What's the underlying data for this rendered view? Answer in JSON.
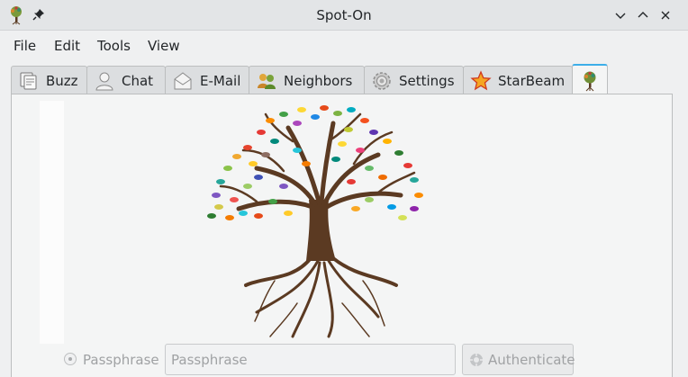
{
  "window": {
    "title": "Spot-On",
    "icons": [
      "app-tree-icon",
      "pin-icon",
      "minimize-icon",
      "maximize-icon",
      "close-icon"
    ]
  },
  "menubar": {
    "items": [
      {
        "label": "File"
      },
      {
        "label": "Edit"
      },
      {
        "label": "Tools"
      },
      {
        "label": "View"
      }
    ]
  },
  "tabs": [
    {
      "label": "Buzz",
      "icon": "buzz-icon"
    },
    {
      "label": "Chat",
      "icon": "chat-person-icon"
    },
    {
      "label": "E-Mail",
      "icon": "email-envelope-icon"
    },
    {
      "label": "Neighbors",
      "icon": "neighbors-people-icon"
    },
    {
      "label": "Settings",
      "icon": "settings-gear-icon"
    },
    {
      "label": "StarBeam",
      "icon": "starbeam-star-icon"
    },
    {
      "label": "",
      "icon": "tree-icon",
      "selected": true
    }
  ],
  "auth": {
    "radio_label": "Passphrase",
    "input_placeholder": "Passphrase",
    "input_value": "",
    "button_label": "Authenticate"
  },
  "colors": {
    "accent": "#3daee9",
    "window_bg": "#eff0f1",
    "disabled_text": "#a0a2a4"
  }
}
